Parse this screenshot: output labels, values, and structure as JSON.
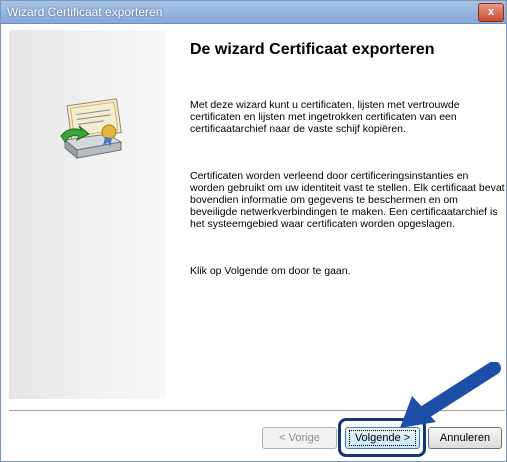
{
  "window": {
    "title": "Wizard Certificaat exporteren",
    "close_label": "x"
  },
  "sidebar": {
    "icon": "certificate-export-icon"
  },
  "main": {
    "heading": "De wizard Certificaat exporteren",
    "paragraphs": [
      "Met deze wizard kunt u certificaten, lijsten met vertrouwde certificaten en lijsten met ingetrokken certificaten van een certificaatarchief naar de vaste schijf kopiëren.",
      "Certificaten worden verleend door certificeringsinstanties en worden gebruikt om uw identiteit vast te stellen. Elk certificaat bevat bovendien informatie om gegevens te beschermen en om beveiligde netwerkverbindingen te maken. Een certificaatarchief is het systeemgebied waar certificaten worden opgeslagen.",
      "Klik op Volgende om door te gaan."
    ]
  },
  "buttons": {
    "back": "< Vorige",
    "next": "Volgende >",
    "cancel": "Annuleren"
  },
  "annotation": {
    "arrow_color": "#1e4fa8",
    "highlight_color": "#13367a"
  }
}
